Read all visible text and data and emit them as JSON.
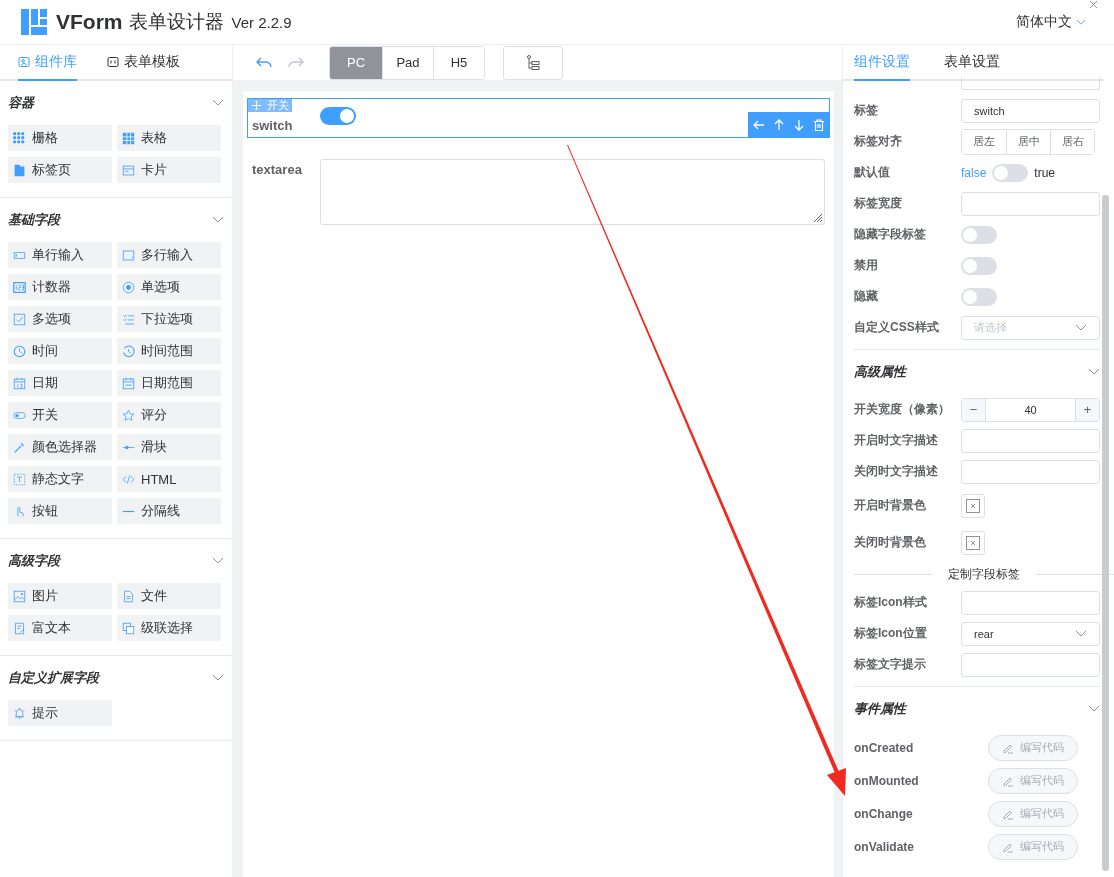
{
  "header": {
    "logo_text": "VForm",
    "title": "表单设计器",
    "version": "Ver 2.2.9",
    "language": "简体中文"
  },
  "left_tabs": [
    {
      "label": "组件库",
      "selected": true
    },
    {
      "label": "表单模板",
      "selected": false
    }
  ],
  "groups": [
    {
      "title": "容器",
      "expanded": true,
      "items": [
        "栅格",
        "表格",
        "标签页",
        "卡片"
      ]
    },
    {
      "title": "基础字段",
      "expanded": true,
      "items": [
        "单行输入",
        "多行输入",
        "计数器",
        "单选项",
        "多选项",
        "下拉选项",
        "时间",
        "时间范围",
        "日期",
        "日期范围",
        "开关",
        "评分",
        "颜色选择器",
        "滑块",
        "静态文字",
        "HTML",
        "按钮",
        "分隔线"
      ]
    },
    {
      "title": "高级字段",
      "expanded": true,
      "items": [
        "图片",
        "文件",
        "富文本",
        "级联选择"
      ]
    },
    {
      "title": "自定义扩展字段",
      "expanded": true,
      "items": [
        "提示"
      ]
    }
  ],
  "toolbar": {
    "devices": [
      {
        "label": "PC",
        "selected": true
      },
      {
        "label": "Pad",
        "selected": false
      },
      {
        "label": "H5",
        "selected": false
      }
    ]
  },
  "canvas": {
    "widgets": [
      {
        "kind": "switch",
        "label": "switch",
        "handle": "开关",
        "on": true,
        "selected": true
      },
      {
        "kind": "textarea",
        "label": "textarea",
        "selected": false
      }
    ]
  },
  "right_tabs": [
    {
      "label": "组件设置",
      "selected": true
    },
    {
      "label": "表单设置",
      "selected": false
    }
  ],
  "settings": [
    {
      "kind": "input-cut"
    },
    {
      "kind": "input",
      "label": "标签",
      "value": "switch"
    },
    {
      "kind": "button-group",
      "label": "标签对齐",
      "options": [
        "居左",
        "居中",
        "居右"
      ]
    },
    {
      "kind": "bool-switch",
      "label": "默认值",
      "off_text": "false",
      "on_text": "true",
      "on": false
    },
    {
      "kind": "input",
      "label": "标签宽度"
    },
    {
      "kind": "switch",
      "label": "隐藏字段标签",
      "on": false
    },
    {
      "kind": "switch",
      "label": "禁用",
      "on": false
    },
    {
      "kind": "switch",
      "label": "隐藏",
      "on": false
    },
    {
      "kind": "select",
      "label": "自定义CSS样式",
      "placeholder": "请选择"
    },
    {
      "kind": "section",
      "title": "高级属性",
      "expanded": true
    },
    {
      "kind": "number",
      "label": "开关宽度（像素）",
      "value": "40",
      "minus": "−",
      "plus": "+"
    },
    {
      "kind": "input",
      "label": "开启时文字描述"
    },
    {
      "kind": "input",
      "label": "关闭时文字描述"
    },
    {
      "kind": "color",
      "label": "开启时背景色"
    },
    {
      "kind": "color",
      "label": "关闭时背景色"
    },
    {
      "kind": "divider-text",
      "title": "定制字段标签"
    },
    {
      "kind": "input",
      "label": "标签Icon样式"
    },
    {
      "kind": "select",
      "label": "标签Icon位置",
      "value": "rear"
    },
    {
      "kind": "input",
      "label": "标签文字提示"
    },
    {
      "kind": "section",
      "title": "事件属性",
      "expanded": true
    },
    {
      "kind": "event",
      "label": "onCreated",
      "button": "编写代码"
    },
    {
      "kind": "event",
      "label": "onMounted",
      "button": "编写代码"
    },
    {
      "kind": "event",
      "label": "onChange",
      "button": "编写代码"
    },
    {
      "kind": "event",
      "label": "onValidate",
      "button": "编写代码"
    }
  ]
}
